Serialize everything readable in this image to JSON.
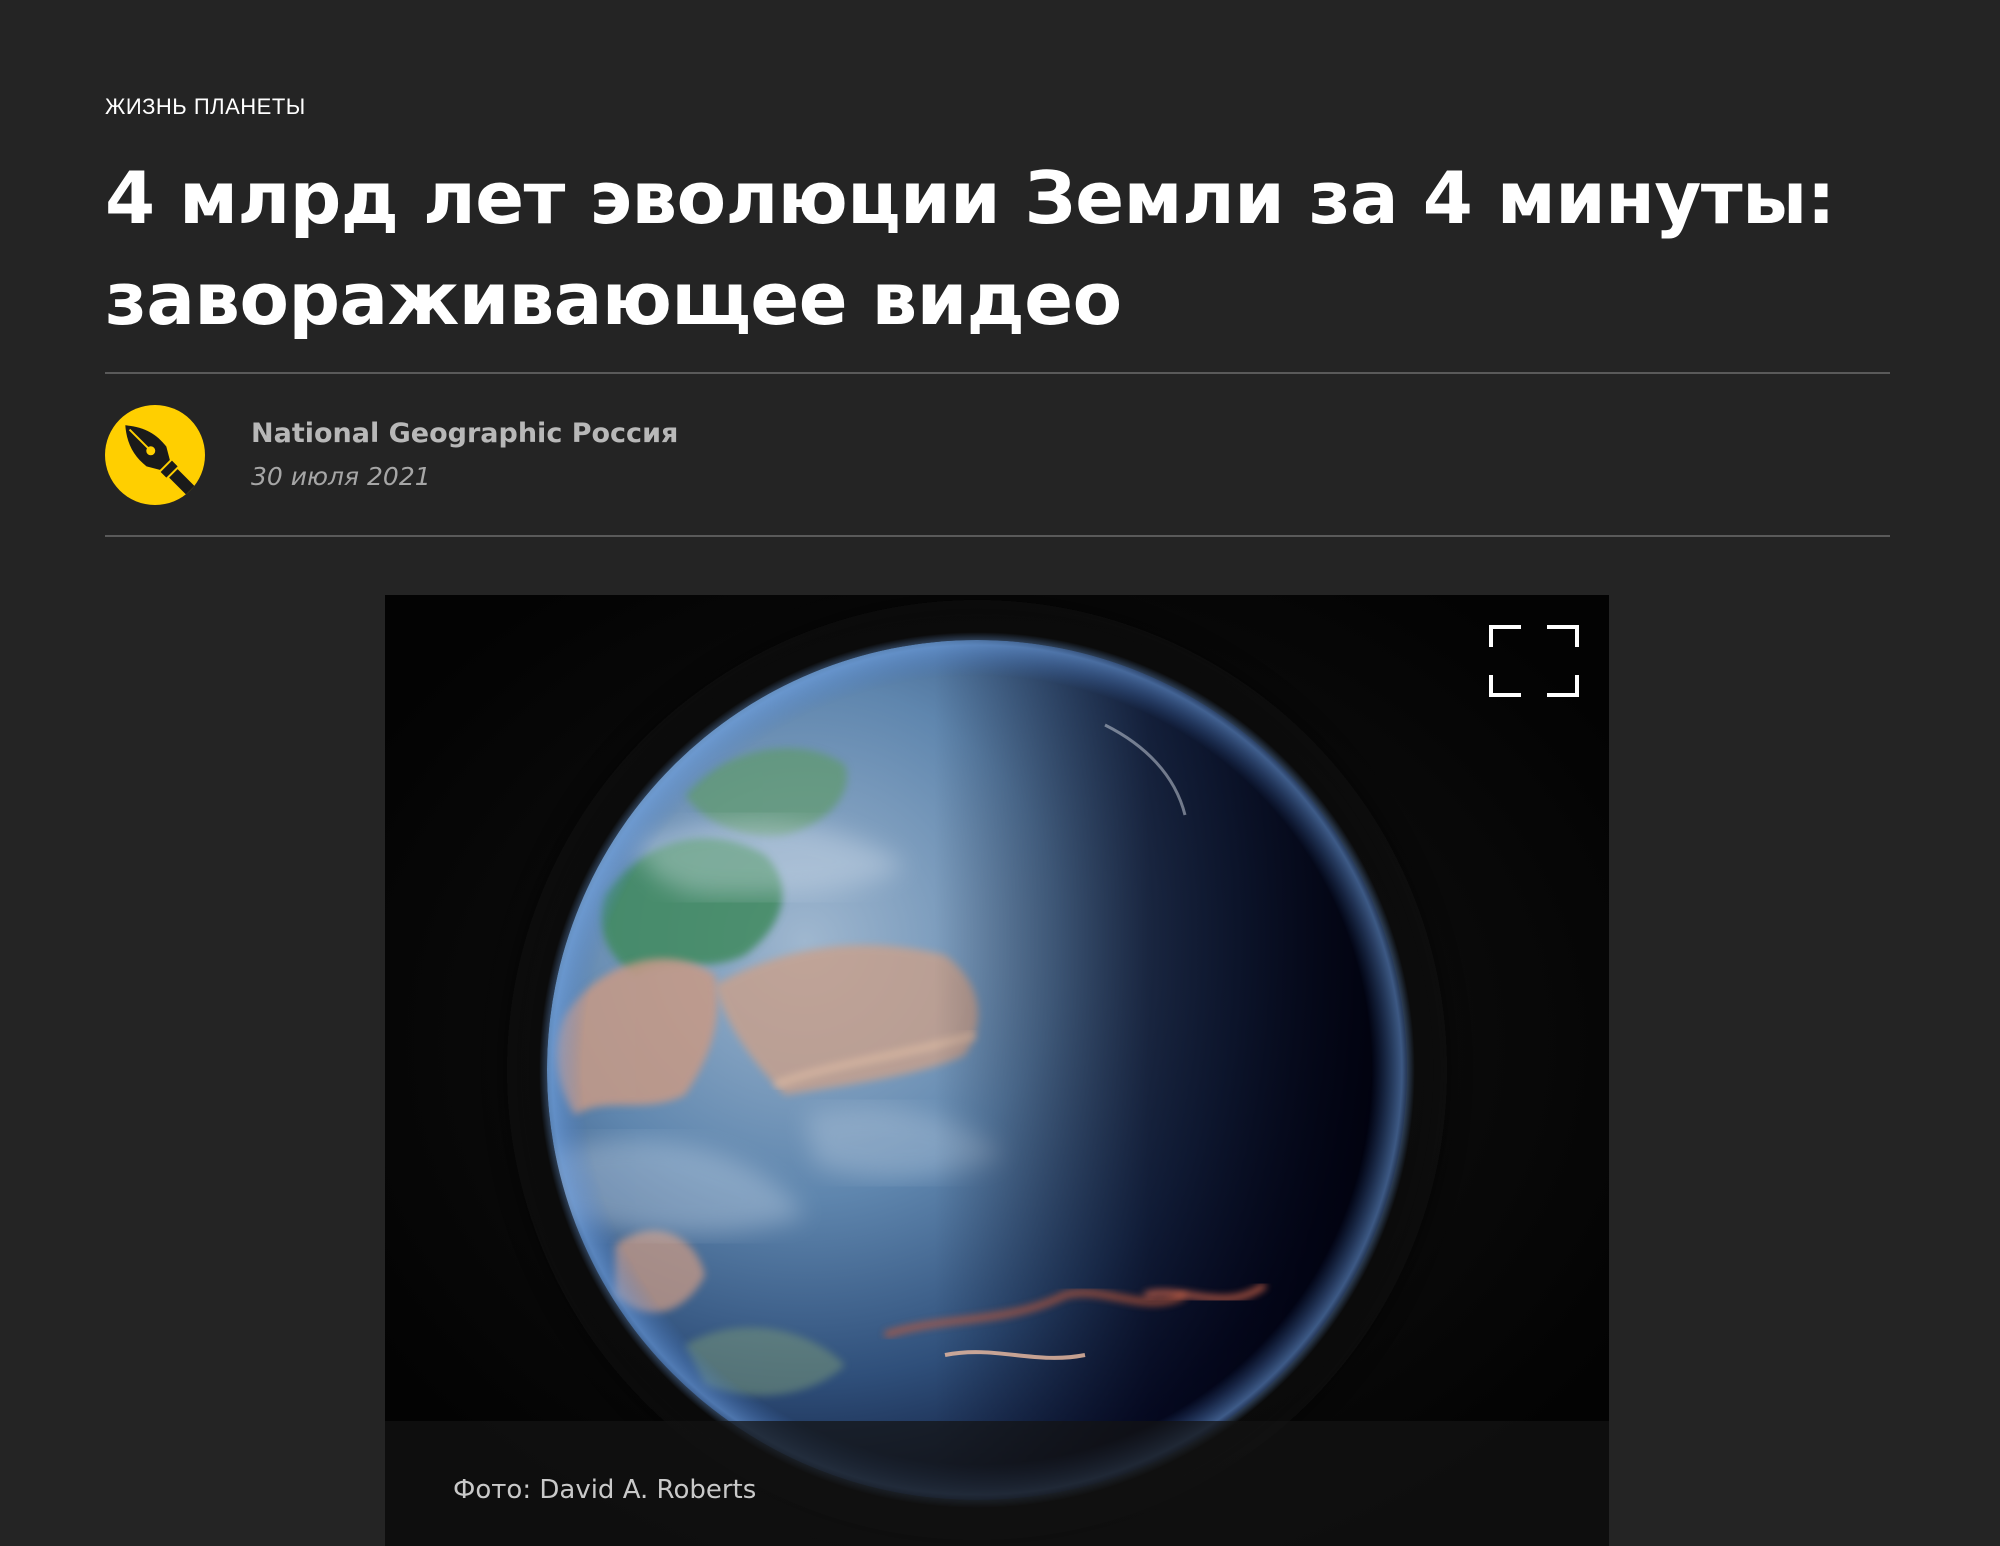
{
  "article": {
    "category": "ЖИЗНЬ ПЛАНЕТЫ",
    "title_line1": "4 млрд лет эволюции Земли за 4 минуты:",
    "title_line2": "завораживающее видео"
  },
  "author": {
    "name": "National Geographic Россия",
    "date": "30 июля 2021",
    "avatar_icon": "fountain-pen-nib-icon",
    "avatar_color": "#ffcf00"
  },
  "media": {
    "caption": "Фото: David A. Roberts",
    "fullscreen_icon": "fullscreen-expand-icon",
    "image_subject": "planet-earth-globe"
  },
  "colors": {
    "background": "#242424",
    "divider": "#5a5a5a",
    "title_text": "#ffffff",
    "meta_text": "#b8b8b8"
  }
}
